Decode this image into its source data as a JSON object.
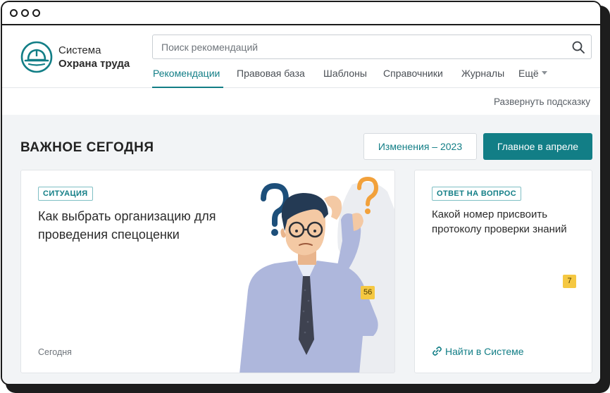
{
  "window": {
    "controls": [
      "close",
      "minimize",
      "maximize"
    ]
  },
  "brand": {
    "line1": "Система",
    "line2": "Охрана труда",
    "logo_icon": "hard-hat-icon",
    "accent_color": "#127e86"
  },
  "search": {
    "placeholder": "Поиск рекомендаций",
    "value": "",
    "icon": "search-icon"
  },
  "nav": {
    "items": [
      {
        "label": "Рекомендации",
        "active": true
      },
      {
        "label": "Правовая база",
        "active": false
      },
      {
        "label": "Шаблоны",
        "active": false
      },
      {
        "label": "Справочники",
        "active": false
      },
      {
        "label": "Журналы",
        "active": false
      },
      {
        "label": "Ещё",
        "active": false
      }
    ]
  },
  "hint": {
    "label": "Развернуть подсказку"
  },
  "section": {
    "title": "ВАЖНОЕ СЕГОДНЯ",
    "buttons": {
      "changes": "Изменения – 2023",
      "april": "Главное в апреле"
    }
  },
  "cards": {
    "main": {
      "tag": "СИТУАЦИЯ",
      "title": "Как выбрать организацию для проведения спецоценки",
      "date": "Сегодня",
      "badge": "56"
    },
    "side": {
      "tag": "ОТВЕТ НА ВОПРОС",
      "title": "Какой номер присвоить протоколу проверки знаний",
      "badge": "7",
      "link": "Найти в Системе",
      "link_icon": "link-icon"
    }
  }
}
